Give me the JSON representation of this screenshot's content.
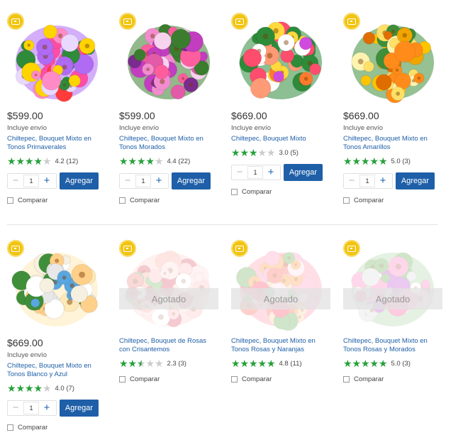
{
  "products": [
    {
      "badge_icon": "gift-icon",
      "price": "$599.00",
      "shipping": "Incluye envío",
      "name": "Chiltepec, Bouquet Mixto en Tonos Primaverales",
      "stars": 4.2,
      "rating_text": "4.2 (12)",
      "quantity": "1",
      "add_label": "Agregar",
      "compare_label": "Comparar",
      "status": "available",
      "palette": [
        "#ffd400",
        "#ff4da6",
        "#ff3b3b",
        "#e9d9ff",
        "#ff8bc6",
        "#b06bf5",
        "#2e8b3a"
      ]
    },
    {
      "badge_icon": "gift-icon",
      "price": "$599.00",
      "shipping": "Incluye envío",
      "name": "Chiltepec, Bouquet Mixto en Tonos Morados",
      "stars": 4.4,
      "rating_text": "4.4 (22)",
      "quantity": "1",
      "add_label": "Agregar",
      "compare_label": "Comparar",
      "status": "available",
      "palette": [
        "#c23dbf",
        "#f28ccf",
        "#7b2b8f",
        "#ff5e9e",
        "#f7d3ee",
        "#3a7d2e",
        "#e35aa8"
      ]
    },
    {
      "badge_icon": "gift-icon",
      "price": "$669.00",
      "shipping": "Incluye envío",
      "name": "Chiltepec, Bouquet Mixto",
      "stars": 3.0,
      "rating_text": "3.0 (5)",
      "quantity": "1",
      "add_label": "Agregar",
      "compare_label": "Comparar",
      "status": "available",
      "palette": [
        "#ff7a2f",
        "#ff4d6d",
        "#ffd93d",
        "#d04ae0",
        "#ffffff",
        "#2e8b3a",
        "#ff9a76"
      ]
    },
    {
      "badge_icon": "gift-icon",
      "price": "$669.00",
      "shipping": "Incluye envío",
      "name": "Chiltepec, Bouquet Mixto en Tonos Amarillos",
      "stars": 5.0,
      "rating_text": "5.0 (3)",
      "quantity": "1",
      "add_label": "Agregar",
      "compare_label": "Comparar",
      "status": "available",
      "palette": [
        "#ffc400",
        "#ff8c1a",
        "#ffe066",
        "#f0a500",
        "#fff3b0",
        "#3e8e3a",
        "#e06d00"
      ]
    },
    {
      "badge_icon": "gift-icon",
      "price": "$669.00",
      "shipping": "Incluye envío",
      "name": "Chiltepec, Bouquet Mixto en Tonos Blanco y Azul",
      "stars": 4.0,
      "rating_text": "4.0 (7)",
      "quantity": "1",
      "add_label": "Agregar",
      "compare_label": "Comparar",
      "status": "available",
      "palette": [
        "#ffffff",
        "#f6f0e0",
        "#5aa7e0",
        "#ffd08a",
        "#3f8f3a",
        "#ffe9b8",
        "#e8e8e8"
      ]
    },
    {
      "badge_icon": "gift-icon",
      "sold_out_label": "Agotado",
      "name": "Chiltepec, Bouquet de Rosas con Crisantemos",
      "stars": 2.5,
      "rating_text": "2.3 (3)",
      "compare_label": "Comparar",
      "status": "sold_out",
      "palette": [
        "#f08a8a",
        "#ffc2c2",
        "#e05d6f",
        "#ffdada",
        "#7fbf6a",
        "#ffb3a7",
        "#ffffff"
      ]
    },
    {
      "badge_icon": "gift-icon",
      "sold_out_label": "Agotado",
      "name": "Chiltepec, Bouquet Mixto en Tonos Rosas y Naranjas",
      "stars": 5.0,
      "rating_text": "4.8 (11)",
      "compare_label": "Comparar",
      "status": "sold_out",
      "palette": [
        "#ff6f61",
        "#ffa24c",
        "#ff9ec4",
        "#ffd1a8",
        "#6fb05a",
        "#ff4d6d",
        "#ffe0e8"
      ]
    },
    {
      "badge_icon": "gift-icon",
      "sold_out_label": "Agotado",
      "name": "Chiltepec, Bouquet Mixto en Tonos Rosas y Morados",
      "stars": 5.0,
      "rating_text": "5.0 (3)",
      "compare_label": "Comparar",
      "status": "sold_out",
      "palette": [
        "#ff5fa2",
        "#c45ad1",
        "#ffc4e0",
        "#ff86c0",
        "#e0e0e0",
        "#6fb05a",
        "#ffffff"
      ]
    }
  ]
}
